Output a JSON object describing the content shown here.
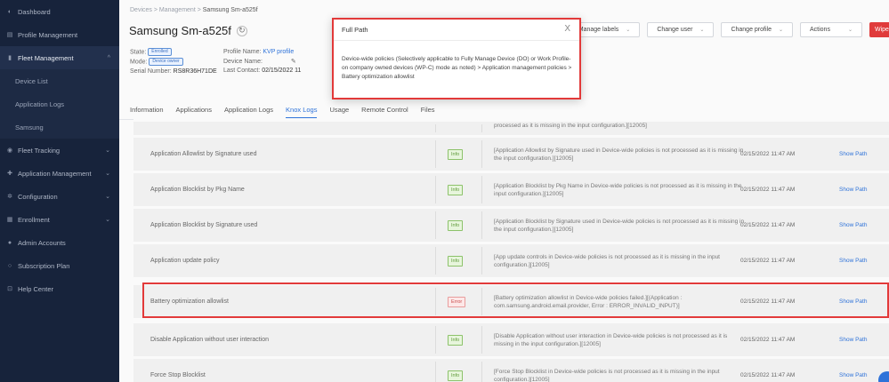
{
  "sidebar": {
    "items": [
      {
        "label": "Dashboard",
        "icon": "dashboard-icon",
        "glyph": "◐",
        "chev": ""
      },
      {
        "label": "Profile Management",
        "icon": "profile-icon",
        "glyph": "▤",
        "chev": ""
      },
      {
        "label": "Fleet Management",
        "icon": "fleet-icon",
        "glyph": "▮",
        "chev": "^"
      },
      {
        "label": "Device List",
        "icon": "",
        "glyph": "",
        "chev": ""
      },
      {
        "label": "Application Logs",
        "icon": "",
        "glyph": "",
        "chev": ""
      },
      {
        "label": "Samsung",
        "icon": "",
        "glyph": "",
        "chev": ""
      },
      {
        "label": "Fleet Tracking",
        "icon": "location-icon",
        "glyph": "◉",
        "chev": "⌄"
      },
      {
        "label": "Application Management",
        "icon": "app-icon",
        "glyph": "✚",
        "chev": "⌄"
      },
      {
        "label": "Configuration",
        "icon": "gear-icon",
        "glyph": "✲",
        "chev": "⌄"
      },
      {
        "label": "Enrollment",
        "icon": "enroll-icon",
        "glyph": "▦",
        "chev": "⌄"
      },
      {
        "label": "Admin Accounts",
        "icon": "admin-icon",
        "glyph": "●",
        "chev": ""
      },
      {
        "label": "Subscription Plan",
        "icon": "subscription-icon",
        "glyph": "○",
        "chev": ""
      },
      {
        "label": "Help Center",
        "icon": "help-icon",
        "glyph": "⊡",
        "chev": ""
      }
    ]
  },
  "header": {
    "breadcrumb": [
      "Devices",
      "Management",
      "Samsung Sm-a525f"
    ],
    "breadcrumb_sep": ">",
    "title": "Samsung Sm-a525f",
    "sync_glyph": "↻",
    "state_label": "State:",
    "state_value": "Enrolled",
    "mode_label": "Mode:",
    "mode_value": "Device owner",
    "serial_label": "Serial Number:",
    "serial_value": "RS8R36H71DE",
    "profile_label": "Profile Name:",
    "profile_value": "KVP profile",
    "devname_label": "Device Name:",
    "devname_value": "",
    "edit_glyph": "✎",
    "contact_label": "Last Contact:",
    "contact_value": "02/15/2022 11"
  },
  "actions": {
    "manage_labels": "Manage labels",
    "change_user": "Change user",
    "change_profile": "Change profile",
    "actions": "Actions",
    "wipe": "Wipe",
    "dd_glyph": "⌄"
  },
  "tabs": [
    "Information",
    "Applications",
    "Application Logs",
    "Knox Logs",
    "Usage",
    "Remote Control",
    "Files"
  ],
  "active_tab": "Knox Logs",
  "rows": [
    {
      "name": "",
      "status": "",
      "message": "processed as it is missing in the input configuration.][12005]",
      "date": "",
      "action": ""
    },
    {
      "name": "Application Allowlist by Signature used",
      "status": "Info",
      "message": "[Application Allowlist by Signature used in Device-wide policies is not processed as it is missing in the input configuration.][12005]",
      "date": "02/15/2022 11:47 AM",
      "action": "Show Path"
    },
    {
      "name": "Application Blocklist by Pkg Name",
      "status": "Info",
      "message": "[Application Blocklist by Pkg Name in Device-wide policies is not processed as it is missing in the input configuration.][12005]",
      "date": "02/15/2022 11:47 AM",
      "action": "Show Path"
    },
    {
      "name": "Application Blocklist by Signature used",
      "status": "Info",
      "message": "[Application Blocklist by Signature used in Device-wide policies is not processed as it is missing in the input configuration.][12005]",
      "date": "02/15/2022 11:47 AM",
      "action": "Show Path"
    },
    {
      "name": "Application update policy",
      "status": "Info",
      "message": "[App update controls in Device-wide policies is not processed as it is missing in the input configuration.][12005]",
      "date": "02/15/2022 11:47 AM",
      "action": "Show Path"
    },
    {
      "name": "Battery optimization allowlist",
      "status": "Error",
      "message": "[Battery optimization allowlist in Device-wide policies failed.][(Application : com.samsung.android.email.provider, Error : ERROR_INVALID_INPUT)]",
      "date": "02/15/2022 11:47 AM",
      "action": "Show Path"
    },
    {
      "name": "Disable Application without user interaction",
      "status": "Info",
      "message": "[Disable Application without user interaction in Device-wide policies is not processed as it is missing in the input configuration.][12005]",
      "date": "02/15/2022 11:47 AM",
      "action": "Show Path"
    },
    {
      "name": "Force Stop Blocklist",
      "status": "Info",
      "message": "[Force Stop Blocklist in Device-wide policies is not processed as it is missing in the input configuration.][12005]",
      "date": "02/15/2022 11:47 AM",
      "action": "Show Path"
    }
  ],
  "modal": {
    "title": "Full Path",
    "close_glyph": "X",
    "body": "Device-wide policies (Selectively applicable to Fully Manage Device (DO) or Work Profile-on company owned devices (WP-C) mode as noted) > Application management policies > Battery optimization allowlist"
  },
  "colors": {
    "sidebar_bg": "#17233b",
    "accent": "#2f73d9",
    "highlight": "#e23a3a",
    "wipe": "#e03b3b"
  }
}
